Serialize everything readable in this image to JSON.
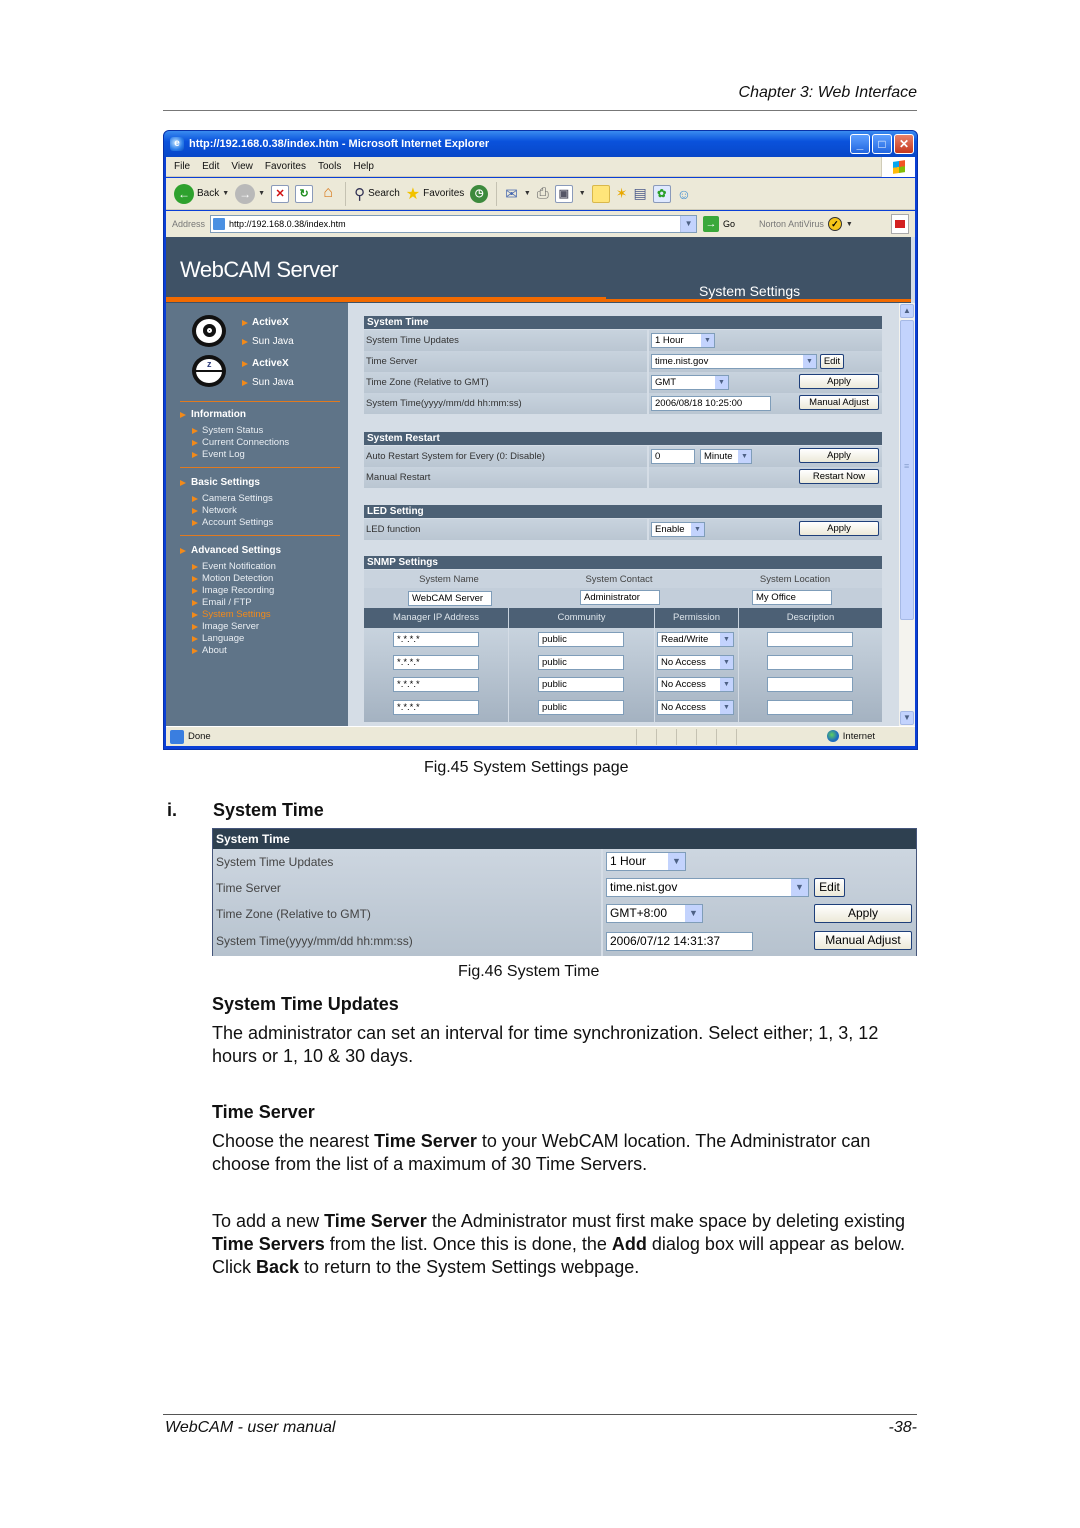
{
  "doc": {
    "header": "Chapter 3: Web Interface",
    "footer_left": "WebCAM - user manual",
    "footer_right": "-38-"
  },
  "browser": {
    "title": "http://192.168.0.38/index.htm - Microsoft Internet Explorer",
    "menu": [
      "File",
      "Edit",
      "View",
      "Favorites",
      "Tools",
      "Help"
    ],
    "toolbar": {
      "back": "Back",
      "search": "Search",
      "favorites": "Favorites"
    },
    "address_label": "Address",
    "address_value": "http://192.168.0.38/index.htm",
    "go_label": "Go",
    "norton_label": "Norton AntiVirus",
    "status_text": "Done",
    "status_zone": "Internet"
  },
  "app": {
    "title": "WebCAM Server",
    "page_title": "System Settings",
    "sidebar": {
      "viewer_links": [
        "ActiveX",
        "Sun Java",
        "ActiveX",
        "Sun Java"
      ],
      "groups": [
        {
          "heading": "Information",
          "items": [
            "System Status",
            "Current Connections",
            "Event Log"
          ]
        },
        {
          "heading": "Basic Settings",
          "items": [
            "Camera Settings",
            "Network",
            "Account Settings"
          ]
        },
        {
          "heading": "Advanced Settings",
          "items": [
            "Event Notification",
            "Motion Detection",
            "Image Recording",
            "Email / FTP",
            "System Settings",
            "Image Server",
            "Language",
            "About"
          ]
        }
      ],
      "active_item": "System Settings"
    },
    "system_time": {
      "heading": "System Time",
      "rows": [
        {
          "label": "System Time Updates",
          "value": "1 Hour"
        },
        {
          "label": "Time Server",
          "value": "time.nist.gov",
          "button": "Edit"
        },
        {
          "label": "Time Zone (Relative to GMT)",
          "value": "GMT",
          "button": "Apply"
        },
        {
          "label": "System Time(yyyy/mm/dd hh:mm:ss)",
          "value": "2006/08/18 10:25:00",
          "button": "Manual Adjust"
        }
      ]
    },
    "system_restart": {
      "heading": "System Restart",
      "auto_label": "Auto Restart System for Every (0: Disable)",
      "auto_value": "0",
      "auto_unit": "Minute",
      "auto_button": "Apply",
      "manual_label": "Manual Restart",
      "manual_button": "Restart Now"
    },
    "led": {
      "heading": "LED Setting",
      "label": "LED function",
      "value": "Enable",
      "button": "Apply"
    },
    "snmp": {
      "heading": "SNMP Settings",
      "info_labels": [
        "System Name",
        "System Contact",
        "System Location"
      ],
      "info_values": [
        "WebCAM Server",
        "Administrator",
        "My Office"
      ],
      "columns": [
        "Manager IP Address",
        "Community",
        "Permission",
        "Description"
      ],
      "rows": [
        {
          "ip": "*.*.*.*",
          "community": "public",
          "permission": "Read/Write",
          "description": ""
        },
        {
          "ip": "*.*.*.*",
          "community": "public",
          "permission": "No Access",
          "description": ""
        },
        {
          "ip": "*.*.*.*",
          "community": "public",
          "permission": "No Access",
          "description": ""
        },
        {
          "ip": "*.*.*.*",
          "community": "public",
          "permission": "No Access",
          "description": ""
        }
      ]
    }
  },
  "captions": {
    "fig45": "Fig.45  System Settings page",
    "fig46": "Fig.46  System Time"
  },
  "section": {
    "number": "i.",
    "title": "System Time"
  },
  "fig46": {
    "heading": "System Time",
    "rows": [
      {
        "label": "System Time Updates",
        "value": "1 Hour"
      },
      {
        "label": "Time Server",
        "value": "time.nist.gov",
        "button": "Edit"
      },
      {
        "label": "Time Zone (Relative to GMT)",
        "value": "GMT+8:00",
        "button": "Apply"
      },
      {
        "label": "System Time(yyyy/mm/dd hh:mm:ss)",
        "value": "2006/07/12 14:31:37",
        "button": "Manual Adjust"
      }
    ]
  },
  "body": {
    "h_updates": "System Time Updates",
    "p_updates": "The administrator can set an interval for time synchronization.   Select either; 1, 3, 12 hours or 1, 10 & 30 days.",
    "h_server": "Time Server",
    "p_server_1": {
      "t1": "Choose the nearest ",
      "b1": "Time Server",
      "t2": " to your WebCAM location.   The Administrator can choose from the list of a maximum of 30 Time Servers."
    },
    "p_server_2": {
      "t1": "To add a new ",
      "b1": "Time Server",
      "t2": " the Administrator must first make space by deleting existing ",
      "b2": "Time Servers",
      "t3": " from the list.   Once this is done, the ",
      "b3": "Add",
      "t4": " dialog box will appear as below.   Click ",
      "b4": "Back",
      "t5": " to return to the System Settings webpage."
    }
  }
}
